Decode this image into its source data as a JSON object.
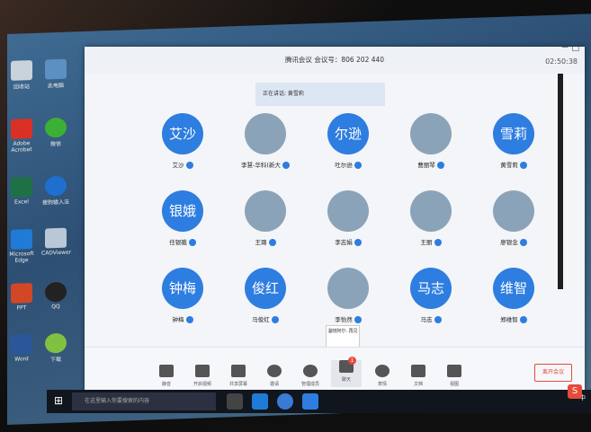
{
  "window": {
    "title": "腾讯会议 会议号：806 202 440",
    "timer": "02:50:38",
    "speaking": "正在讲话: 黄雪莉",
    "controls": "－ □"
  },
  "participants": [
    {
      "avatar_text": "艾沙",
      "name": "艾沙",
      "type": "text"
    },
    {
      "avatar_text": "",
      "name": "李慧-华科(新大",
      "type": "photo"
    },
    {
      "avatar_text": "尔逊",
      "name": "吐尔逊",
      "type": "text"
    },
    {
      "avatar_text": "",
      "name": "曹丽琴",
      "type": "photo"
    },
    {
      "avatar_text": "雪莉",
      "name": "黄雪莉",
      "type": "text"
    },
    {
      "avatar_text": "银娥",
      "name": "任银娥",
      "type": "text"
    },
    {
      "avatar_text": "",
      "name": "王璐",
      "type": "photo"
    },
    {
      "avatar_text": "",
      "name": "李志娟",
      "type": "photo"
    },
    {
      "avatar_text": "",
      "name": "王丽",
      "type": "photo"
    },
    {
      "avatar_text": "",
      "name": "廖银念",
      "type": "photo"
    },
    {
      "avatar_text": "钟梅",
      "name": "钟梅",
      "type": "text"
    },
    {
      "avatar_text": "俊红",
      "name": "马俊红",
      "type": "text"
    },
    {
      "avatar_text": "",
      "name": "李怡然",
      "type": "photo"
    },
    {
      "avatar_text": "马志",
      "name": "马志",
      "type": "text"
    },
    {
      "avatar_text": "维智",
      "name": "郑维智",
      "type": "text"
    }
  ],
  "toolbar": {
    "items": [
      {
        "label": "静音",
        "icon": "mic-icon"
      },
      {
        "label": "开启视频",
        "icon": "video-off-icon"
      },
      {
        "label": "共享屏幕",
        "icon": "share-screen-icon"
      },
      {
        "label": "邀请",
        "icon": "invite-icon"
      },
      {
        "label": "管理成员",
        "icon": "members-icon"
      },
      {
        "label": "聊天",
        "icon": "chat-icon",
        "badge": "1"
      },
      {
        "label": "表情",
        "icon": "emoji-icon"
      },
      {
        "label": "文档",
        "icon": "doc-icon"
      },
      {
        "label": "视图",
        "icon": "view-icon"
      }
    ],
    "end_label": "离开会议",
    "tooltip": "温晓阿尔:\n再见"
  },
  "taskbar": {
    "search_placeholder": "在这里输入你要搜索的内容",
    "tray_text": "^ 中"
  },
  "desktop_icons": [
    {
      "label": "回收站"
    },
    {
      "label": "此电脑"
    },
    {
      "label": "Adobe Acrobat"
    },
    {
      "label": "微信"
    },
    {
      "label": "Excel"
    },
    {
      "label": "搜狗输入法"
    },
    {
      "label": "Microsoft Edge"
    },
    {
      "label": "CADViewer"
    },
    {
      "label": "PPT"
    },
    {
      "label": "QQ"
    },
    {
      "label": "Word"
    },
    {
      "label": "下载"
    }
  ],
  "colors": {
    "accent": "#2e7de0",
    "danger": "#e64a3b"
  }
}
